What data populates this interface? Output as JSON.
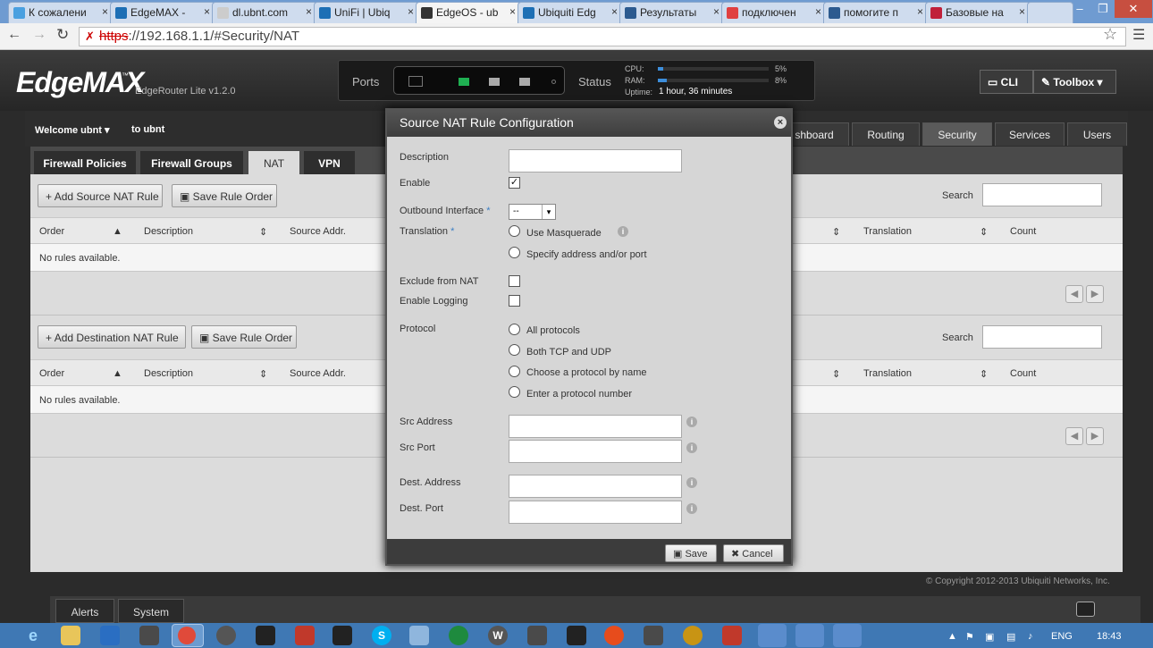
{
  "browser": {
    "tabs": [
      {
        "label": "К сожалени",
        "color": "#4aa0e0"
      },
      {
        "label": "EdgeMAX - ",
        "color": "#1d6fb5"
      },
      {
        "label": "dl.ubnt.com",
        "color": "#cccccc"
      },
      {
        "label": "UniFi | Ubiq",
        "color": "#1d6fb5"
      },
      {
        "label": "EdgeOS - ub",
        "color": "#333333"
      },
      {
        "label": "Ubiquiti Edg",
        "color": "#1d6fb5"
      },
      {
        "label": "Результаты",
        "color": "#2c5a8f"
      },
      {
        "label": "подключен",
        "color": "#e04040"
      },
      {
        "label": "помогите п",
        "color": "#2c5a8f"
      },
      {
        "label": "Базовые на",
        "color": "#c0203a"
      },
      {
        "label": "",
        "color": "#cfdcee"
      }
    ],
    "url_scheme": "https",
    "url_rest": "://192.168.1.1/#Security/NAT"
  },
  "header": {
    "logo": "EdgeMAX",
    "model": "EdgeRouter Lite v1.2.0",
    "ports_label": "Ports",
    "status_label": "Status",
    "cpu_label": "CPU:",
    "cpu_value": "5%",
    "cpu_fraction": 0.05,
    "ram_label": "RAM:",
    "ram_value": "8%",
    "ram_fraction": 0.08,
    "uptime_label": "Uptime:",
    "uptime_value": "1 hour, 36 minutes",
    "cli_label": "CLI",
    "toolbox_label": "Toolbox"
  },
  "nav": {
    "welcome": "Welcome ubnt",
    "to": "to ubnt",
    "tabs": [
      "shboard",
      "Routing",
      "Security",
      "Services",
      "Users"
    ],
    "active_tab": "Security"
  },
  "subtabs": [
    "Firewall Policies",
    "Firewall Groups",
    "NAT",
    "VPN"
  ],
  "source_section": {
    "add_label": "Add Source NAT Rule",
    "save_label": "Save Rule Order",
    "search_label": "Search",
    "columns": [
      "Order",
      "Description",
      "Source Addr.",
      "Translation",
      "Count"
    ],
    "empty": "No rules available."
  },
  "dest_section": {
    "add_label": "Add Destination NAT Rule",
    "save_label": "Save Rule Order",
    "search_label": "Search",
    "columns": [
      "Order",
      "Description",
      "Source Addr.",
      "Translation",
      "Count"
    ],
    "empty": "No rules available."
  },
  "modal": {
    "title": "Source NAT Rule Configuration",
    "description_label": "Description",
    "enable_label": "Enable",
    "enable_checked": "✓",
    "outbound_label": "Outbound Interface",
    "outbound_value": "--",
    "translation_label": "Translation",
    "translation_options": [
      "Use Masquerade",
      "Specify address and/or port"
    ],
    "exclude_label": "Exclude from NAT",
    "logging_label": "Enable Logging",
    "protocol_label": "Protocol",
    "protocol_options": [
      "All protocols",
      "Both TCP and UDP",
      "Choose a protocol by name",
      "Enter a protocol number"
    ],
    "src_address_label": "Src Address",
    "src_port_label": "Src Port",
    "dest_address_label": "Dest. Address",
    "dest_port_label": "Dest. Port",
    "save_label": "Save",
    "cancel_label": "Cancel"
  },
  "footer": {
    "copyright": "© Copyright 2012-2013 Ubiquiti Networks, Inc.",
    "alerts": "Alerts",
    "system": "System"
  },
  "taskbar": {
    "lang": "ENG",
    "time": "18:43"
  }
}
